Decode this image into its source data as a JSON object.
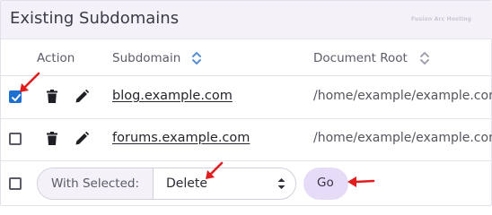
{
  "header": {
    "title": "Existing Subdomains",
    "watermark": "Fusion Arc Hosting"
  },
  "table": {
    "columns": {
      "action": "Action",
      "subdomain": "Subdomain",
      "document_root": "Document Root"
    },
    "rows": [
      {
        "checked": true,
        "subdomain": "blog.example.com",
        "document_root": "/home/example/example.com"
      },
      {
        "checked": false,
        "subdomain": "forums.example.com",
        "document_root": "/home/example/example.com"
      }
    ]
  },
  "bulk_action": {
    "label": "With Selected:",
    "selected": "Delete",
    "go_label": "Go",
    "checked": false
  },
  "icons": {
    "trash": "trash-icon",
    "edit": "pencil-icon",
    "sort": "sort-icon",
    "select": "updown-chevron-icon",
    "annotation": "red-arrow-icon"
  },
  "colors": {
    "header_bg": "#f4f1f9",
    "checkbox_checked": "#1f6fd1",
    "go_button_bg": "#e6dcf8",
    "annotation_arrow": "#e11d1d"
  }
}
